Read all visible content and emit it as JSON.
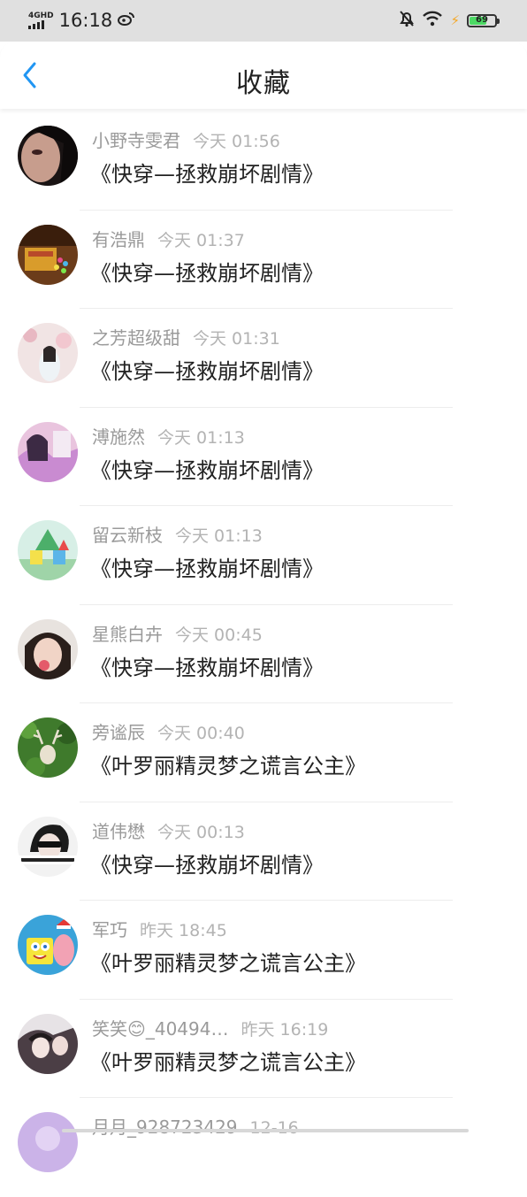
{
  "status_bar": {
    "network": "4GHD",
    "time": "16:18",
    "battery": "69",
    "battery_level_pct": 69
  },
  "header": {
    "title": "收藏",
    "back_icon": "chevron-left-icon"
  },
  "colors": {
    "accent": "#2196f3",
    "name_gray": "#9a9a9a",
    "time_gray": "#b3b3b3",
    "battery_green": "#4cd964"
  },
  "favorites": [
    {
      "name": "小野寺雯君",
      "time": "今天 01:56",
      "book": "《快穿—拯救崩坏剧情》"
    },
    {
      "name": "有浩鼎",
      "time": "今天 01:37",
      "book": "《快穿—拯救崩坏剧情》"
    },
    {
      "name": "之芳超级甜",
      "time": "今天 01:31",
      "book": "《快穿—拯救崩坏剧情》"
    },
    {
      "name": "溥施然",
      "time": "今天 01:13",
      "book": "《快穿—拯救崩坏剧情》"
    },
    {
      "name": "留云新枝",
      "time": "今天 01:13",
      "book": "《快穿—拯救崩坏剧情》"
    },
    {
      "name": "星熊白卉",
      "time": "今天 00:45",
      "book": "《快穿—拯救崩坏剧情》"
    },
    {
      "name": "旁谧辰",
      "time": "今天 00:40",
      "book": "《叶罗丽精灵梦之谎言公主》"
    },
    {
      "name": "道伟懋",
      "time": "今天 00:13",
      "book": "《快穿—拯救崩坏剧情》"
    },
    {
      "name": "军巧",
      "time": "昨天 18:45",
      "book": "《叶罗丽精灵梦之谎言公主》"
    },
    {
      "name": "笑笑😊_40494…",
      "time": "昨天 16:19",
      "book": "《叶罗丽精灵梦之谎言公主》"
    },
    {
      "name": "月月_928723429",
      "time": "12-16",
      "book": ""
    }
  ]
}
